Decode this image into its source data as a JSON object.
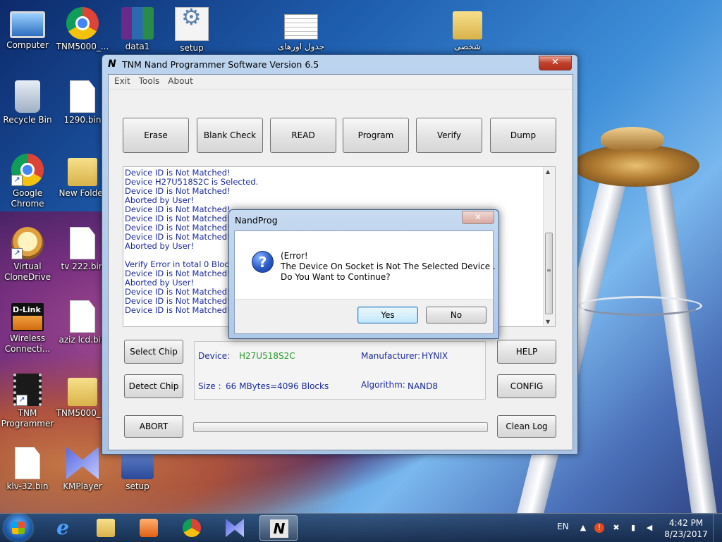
{
  "desktop": {
    "icons": [
      {
        "label": "Computer",
        "icon": "computer-icon"
      },
      {
        "label": "TNM5000_...",
        "icon": "chrome-icon"
      },
      {
        "label": "data1",
        "icon": "winrar-icon"
      },
      {
        "label": "setup",
        "icon": "setup-icon"
      },
      {
        "label": "جدول اورهای",
        "icon": "spreadsheet-icon"
      },
      {
        "label": "شخصی",
        "icon": "folder-icon"
      },
      {
        "label": "Recycle Bin",
        "icon": "recycle-bin-icon"
      },
      {
        "label": "1290.bin",
        "icon": "file-icon"
      },
      {
        "label": "Google Chrome",
        "icon": "chrome-icon"
      },
      {
        "label": "New Folder",
        "icon": "folder-icon"
      },
      {
        "label": "Virtual CloneDrive",
        "icon": "clonedrive-icon"
      },
      {
        "label": "tv 222.bin",
        "icon": "file-icon"
      },
      {
        "label": "Wireless Connecti...",
        "icon": "dlink-icon"
      },
      {
        "label": "aziz lcd.bin",
        "icon": "file-icon"
      },
      {
        "label": "TNM Programmer",
        "icon": "chip-icon"
      },
      {
        "label": "TNM5000_...",
        "icon": "folder-icon"
      },
      {
        "label": "klv-32.bin",
        "icon": "file-icon"
      },
      {
        "label": "KMPlayer",
        "icon": "kmplayer-icon"
      },
      {
        "label": "setup",
        "icon": "installer-icon"
      }
    ]
  },
  "window": {
    "title": "TNM  Nand Programmer Software     Version 6.5",
    "close_label": "✕",
    "menu": [
      "Exit",
      "Tools",
      "About"
    ],
    "top_buttons": [
      "Erase",
      "Blank  Check",
      "READ",
      "Program",
      "Verify",
      "Dump"
    ],
    "log_lines": [
      "Device ID is Not Matched!",
      "Device H27U518S2C is Selected.",
      "Device ID is Not Matched!",
      "Aborted by User!",
      "Device ID is Not Matched!",
      "Device ID is Not Matched!",
      "Device ID is Not Matched!",
      "Device ID is Not Matched!",
      "Aborted by User!",
      "",
      "Verify Error in total 0 Blocks.",
      "Device ID is Not Matched!",
      "Aborted by User!",
      "Device ID is Not Matched!",
      "Device ID is Not Matched!",
      "Device ID is Not Matched!"
    ],
    "left_buttons": {
      "select_chip": "Select Chip",
      "detect_chip": "Detect Chip",
      "abort": "ABORT"
    },
    "right_buttons": {
      "help": "HELP",
      "config": "CONFIG",
      "clean_log": "Clean Log"
    },
    "info": {
      "device_label": "Device:",
      "device_value": "H27U518S2C",
      "manufacturer_label": "Manufacturer:",
      "manufacturer_value": "HYNIX",
      "size_label": "Size :",
      "size_value": "66 MBytes=4096 Blocks",
      "algorithm_label": "Algorithm:",
      "algorithm_value": "NAND8"
    },
    "progress": 0
  },
  "dialog": {
    "title": "NandProg",
    "close_label": "✕",
    "icon": "question-icon",
    "message_lines": [
      "(Error!",
      "The Device On Socket is Not The Selected Device .",
      "Do You Want to Continue?"
    ],
    "yes_label": "Yes",
    "no_label": "No"
  },
  "taskbar": {
    "apps": [
      "internet-explorer-icon",
      "file-explorer-icon",
      "media-player-icon",
      "chrome-icon",
      "kmplayer-icon",
      "tnm-programmer-icon"
    ],
    "active_app": "tnm-programmer-icon",
    "language": "EN",
    "time": "4:42 PM",
    "date": "8/23/2017"
  }
}
